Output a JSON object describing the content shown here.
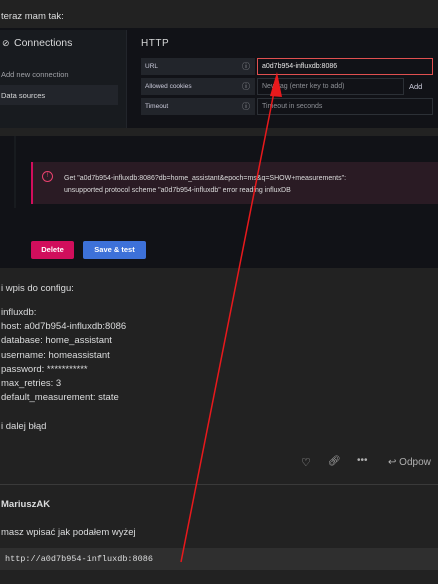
{
  "post1": {
    "intro": "teraz mam tak:",
    "screenshot": {
      "sidebar": {
        "title": "Connections",
        "icon": "link-icon",
        "items": [
          "Add new connection",
          "Data sources"
        ],
        "active_item": "Data sources"
      },
      "http_section": {
        "heading": "HTTP",
        "fields": [
          {
            "label": "URL",
            "value": "a0d7b954-influxdb:8086",
            "placeholder": ""
          },
          {
            "label": "Allowed cookies",
            "value": "",
            "placeholder": "New tag (enter key to add)"
          },
          {
            "label": "Timeout",
            "value": "",
            "placeholder": "Timeout in seconds"
          }
        ],
        "add_label": "Add"
      },
      "error": {
        "line1": "Get \"a0d7b954-influxdb:8086?db=home_assistant&epoch=ms&q=SHOW+measurements\":",
        "line2": "unsupported protocol scheme \"a0d7b954-influxdb\" error reading influxDB"
      },
      "buttons": {
        "delete": "Delete",
        "save_test": "Save & test"
      },
      "colors": {
        "error_accent": "#d10e5c",
        "primary": "#3d71d9"
      }
    },
    "config_intro": "i wpis do configu:",
    "config_lines": [
      "",
      "influxdb:",
      "host: a0d7b954-influxdb:8086",
      "database: home_assistant",
      "username: homeassistant",
      "password: ***********",
      "max_retries: 3",
      "default_measurement: state",
      "",
      "i dalej błąd"
    ],
    "actions": {
      "like_icon": "heart-icon",
      "link_icon": "link-icon",
      "more_icon": "ellipsis-icon",
      "reply_icon": "reply-icon",
      "reply_label": "Odpow"
    }
  },
  "post2": {
    "author": "MariuszAK",
    "text": "masz wpisać jak podałem wyżej",
    "code": "http://a0d7b954-influxdb:8086"
  },
  "annotation_color": "#e8191c"
}
